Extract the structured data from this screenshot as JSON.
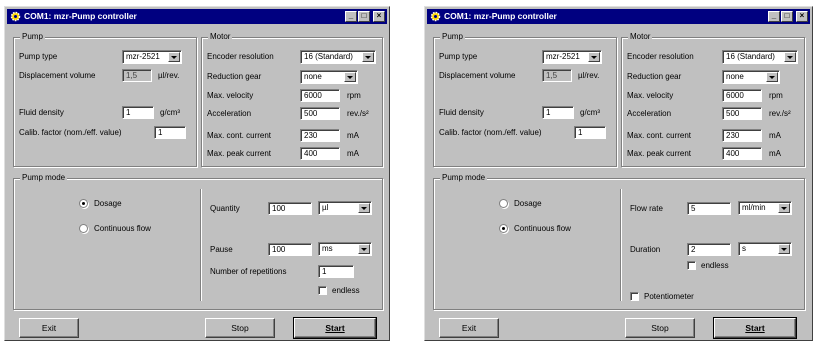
{
  "w1": {
    "title": "COM1: mzr-Pump controller",
    "pump": {
      "group_label": "Pump",
      "type_label": "Pump type",
      "type_value": "mzr-2521",
      "disp_label": "Displacement volume",
      "disp_value": "1,5",
      "disp_unit": "µl/rev.",
      "density_label": "Fluid density",
      "density_value": "1",
      "density_unit": "g/cm³",
      "calib_label": "Calib. factor (nom./eff. value)",
      "calib_value": "1"
    },
    "motor": {
      "group_label": "Motor",
      "enc_label": "Encoder resolution",
      "enc_value": "16 (Standard)",
      "gear_label": "Reduction gear",
      "gear_value": "none",
      "vel_label": "Max. velocity",
      "vel_value": "6000",
      "vel_unit": "rpm",
      "acc_label": "Acceleration",
      "acc_value": "500",
      "acc_unit": "rev./s²",
      "cont_label": "Max. cont. current",
      "cont_value": "230",
      "cont_unit": "mA",
      "peak_label": "Max. peak current",
      "peak_value": "400",
      "peak_unit": "mA"
    },
    "mode": {
      "group_label": "Pump mode",
      "dosage_label": "Dosage",
      "cont_label": "Continuous flow",
      "qty_label": "Quantity",
      "qty_value": "100",
      "qty_unit": "µl",
      "pause_label": "Pause",
      "pause_value": "100",
      "pause_unit": "ms",
      "rep_label": "Number of repetitions",
      "rep_value": "1",
      "endless_label": "endless"
    },
    "buttons": {
      "exit": "Exit",
      "stop": "Stop",
      "start": "Start"
    }
  },
  "w2": {
    "title": "COM1: mzr-Pump controller",
    "pump": {
      "group_label": "Pump",
      "type_label": "Pump type",
      "type_value": "mzr-2521",
      "disp_label": "Displacement volume",
      "disp_value": "1,5",
      "disp_unit": "µl/rev.",
      "density_label": "Fluid density",
      "density_value": "1",
      "density_unit": "g/cm³",
      "calib_label": "Calib. factor (nom./eff. value)",
      "calib_value": "1"
    },
    "motor": {
      "group_label": "Motor",
      "enc_label": "Encoder resolution",
      "enc_value": "16 (Standard)",
      "gear_label": "Reduction gear",
      "gear_value": "none",
      "vel_label": "Max. velocity",
      "vel_value": "6000",
      "vel_unit": "rpm",
      "acc_label": "Acceleration",
      "acc_value": "500",
      "acc_unit": "rev./s²",
      "cont_label": "Max. cont. current",
      "cont_value": "230",
      "cont_unit": "mA",
      "peak_label": "Max. peak current",
      "peak_value": "400",
      "peak_unit": "mA"
    },
    "mode": {
      "group_label": "Pump mode",
      "dosage_label": "Dosage",
      "cont_label": "Continuous flow",
      "flow_label": "Flow rate",
      "flow_value": "5",
      "flow_unit": "ml/min",
      "dur_label": "Duration",
      "dur_value": "2",
      "dur_unit": "s",
      "endless_label": "endless",
      "poti_label": "Potentiometer"
    },
    "buttons": {
      "exit": "Exit",
      "stop": "Stop",
      "start": "Start"
    }
  },
  "colors": {
    "title_bar": "#000080",
    "face": "#c0c0c0"
  }
}
